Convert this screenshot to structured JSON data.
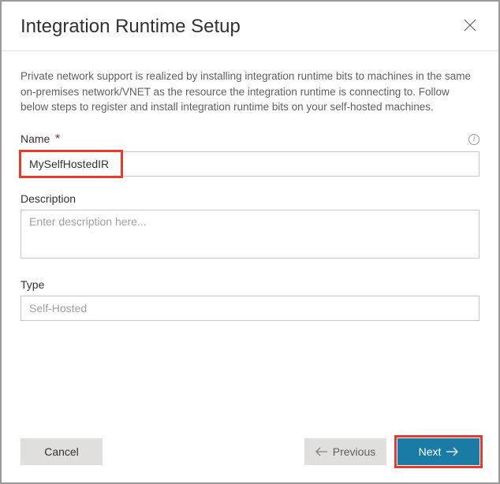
{
  "header": {
    "title": "Integration Runtime Setup"
  },
  "intro": "Private network support is realized by installing integration runtime bits to machines in the same on-premises network/VNET as the resource the integration runtime is connecting to. Follow below steps to register and install integration runtime bits on your self-hosted machines.",
  "fields": {
    "name": {
      "label": "Name",
      "required": "*",
      "value": "MySelfHostedIR"
    },
    "description": {
      "label": "Description",
      "placeholder": "Enter description here..."
    },
    "type": {
      "label": "Type",
      "value": "Self-Hosted"
    }
  },
  "footer": {
    "cancel": "Cancel",
    "previous": "Previous",
    "next": "Next"
  }
}
